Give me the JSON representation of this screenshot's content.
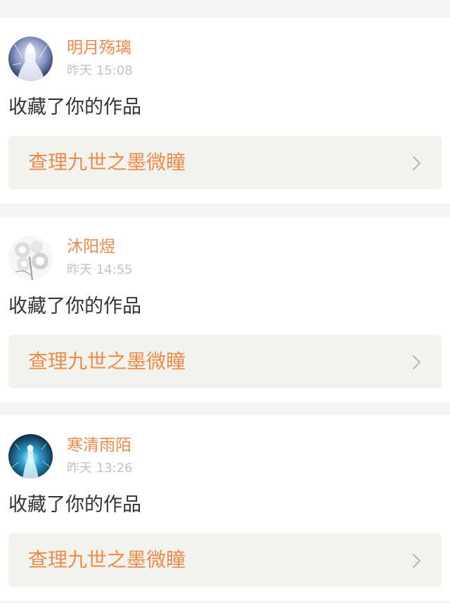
{
  "feed": {
    "items": [
      {
        "username": "明月殇璃",
        "timestamp": "昨天 15:08",
        "action": "收藏了你的作品",
        "work_title": "查理九世之墨微瞳",
        "avatar_icon": "avatar-ice-figure"
      },
      {
        "username": "沐阳煜",
        "timestamp": "昨天 14:55",
        "action": "收藏了你的作品",
        "work_title": "查理九世之墨微瞳",
        "avatar_icon": "avatar-white-flowers"
      },
      {
        "username": "寒清雨陌",
        "timestamp": "昨天 13:26",
        "action": "收藏了你的作品",
        "work_title": "查理九世之墨微瞳",
        "avatar_icon": "avatar-blue-light-figure"
      }
    ]
  },
  "colors": {
    "accent": "#f08a4b",
    "timestamp": "#c3c3c3",
    "text": "#333333",
    "link_bg": "#f3f3ee",
    "page_bg": "#f4f4f4"
  }
}
